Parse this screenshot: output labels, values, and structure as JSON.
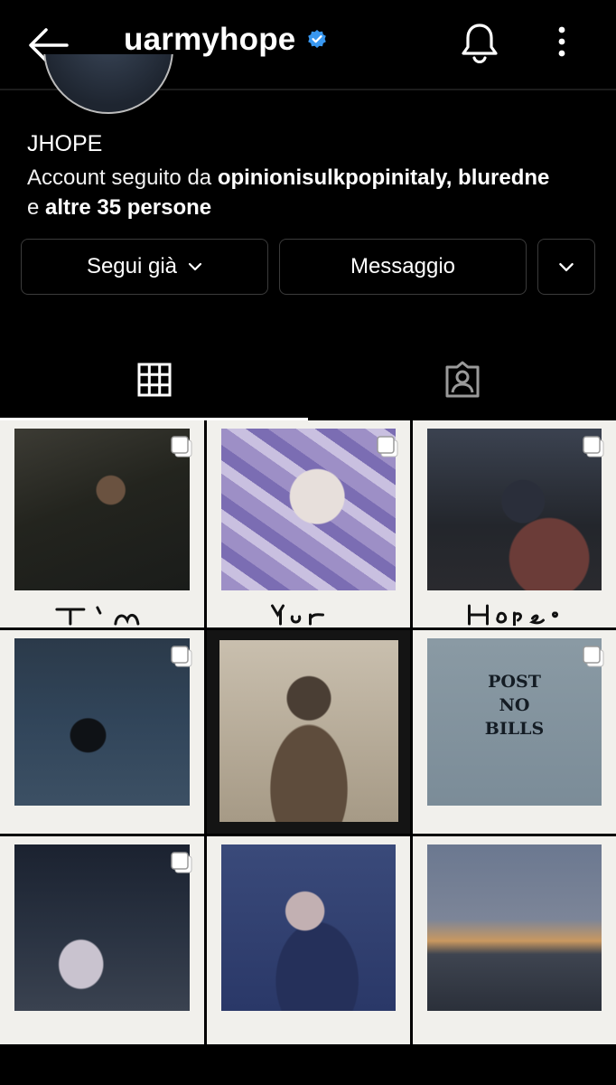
{
  "header": {
    "handle": "uarmyhope",
    "icons": {
      "back": "back-arrow-icon",
      "verified": "verified-badge-icon",
      "bell": "bell-icon",
      "more": "more-vertical-icon"
    }
  },
  "profile": {
    "name": "JHOPE",
    "followed_prefix": "Account seguito da ",
    "followed_names": "opinionisulkpopinitaly, bluredne",
    "followed_line2_prefix": "e ",
    "followed_others": "altre 35 persone"
  },
  "actions": {
    "follow_label": "Segui già",
    "message_label": "Messaggio",
    "suggest_icon": "chevron-down-icon"
  },
  "tabs": [
    {
      "name": "posts-grid",
      "icon": "grid-icon",
      "active": true
    },
    {
      "name": "tagged",
      "icon": "tagged-user-icon",
      "active": false
    }
  ],
  "colors": {
    "background": "#000000",
    "verified": "#3897f0",
    "border": "#3b3b3b"
  },
  "posts": [
    {
      "row": 1,
      "col": 1,
      "multi": true,
      "caption": "I'm"
    },
    {
      "row": 1,
      "col": 2,
      "multi": true,
      "caption": "Your"
    },
    {
      "row": 1,
      "col": 3,
      "multi": true,
      "caption": "Hope"
    },
    {
      "row": 2,
      "col": 1,
      "multi": true,
      "caption": ""
    },
    {
      "row": 2,
      "col": 2,
      "multi": false,
      "caption": ""
    },
    {
      "row": 2,
      "col": 3,
      "multi": true,
      "caption": "POST NO BILLS"
    },
    {
      "row": 3,
      "col": 1,
      "multi": true,
      "caption": ""
    },
    {
      "row": 3,
      "col": 2,
      "multi": false,
      "caption": ""
    },
    {
      "row": 3,
      "col": 3,
      "multi": false,
      "caption": ""
    }
  ]
}
